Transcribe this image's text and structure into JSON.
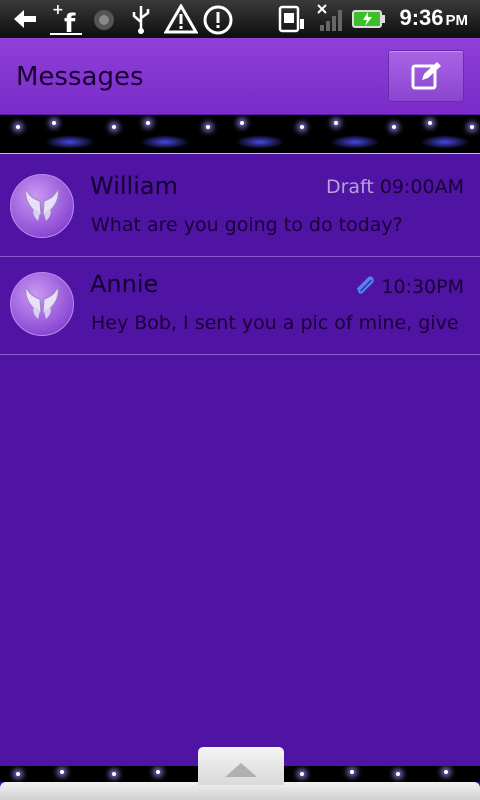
{
  "status_bar": {
    "time": "9:36",
    "ampm": "PM",
    "icons": [
      "back-arrow-icon",
      "facebook-icon",
      "record-icon",
      "usb-icon",
      "warning-icon",
      "alert-icon",
      "sim-icon",
      "no-signal-icon",
      "battery-charging-icon"
    ]
  },
  "header": {
    "title": "Messages",
    "compose_icon": "compose-icon"
  },
  "conversations": [
    {
      "name": "William",
      "draft_label": "Draft",
      "time": "09:00AM",
      "preview": "What are you going to do today?",
      "has_attachment": false,
      "avatar_icon": "wings-icon"
    },
    {
      "name": "Annie",
      "draft_label": "",
      "time": "10:30PM",
      "preview": "Hey Bob, I sent you a pic of mine, give ...",
      "has_attachment": true,
      "avatar_icon": "wings-icon"
    }
  ],
  "colors": {
    "background": "#4f14a4",
    "header": "#8a3ad4",
    "accent_draft": "#b6a2d8",
    "attachment": "#4f86e8"
  }
}
